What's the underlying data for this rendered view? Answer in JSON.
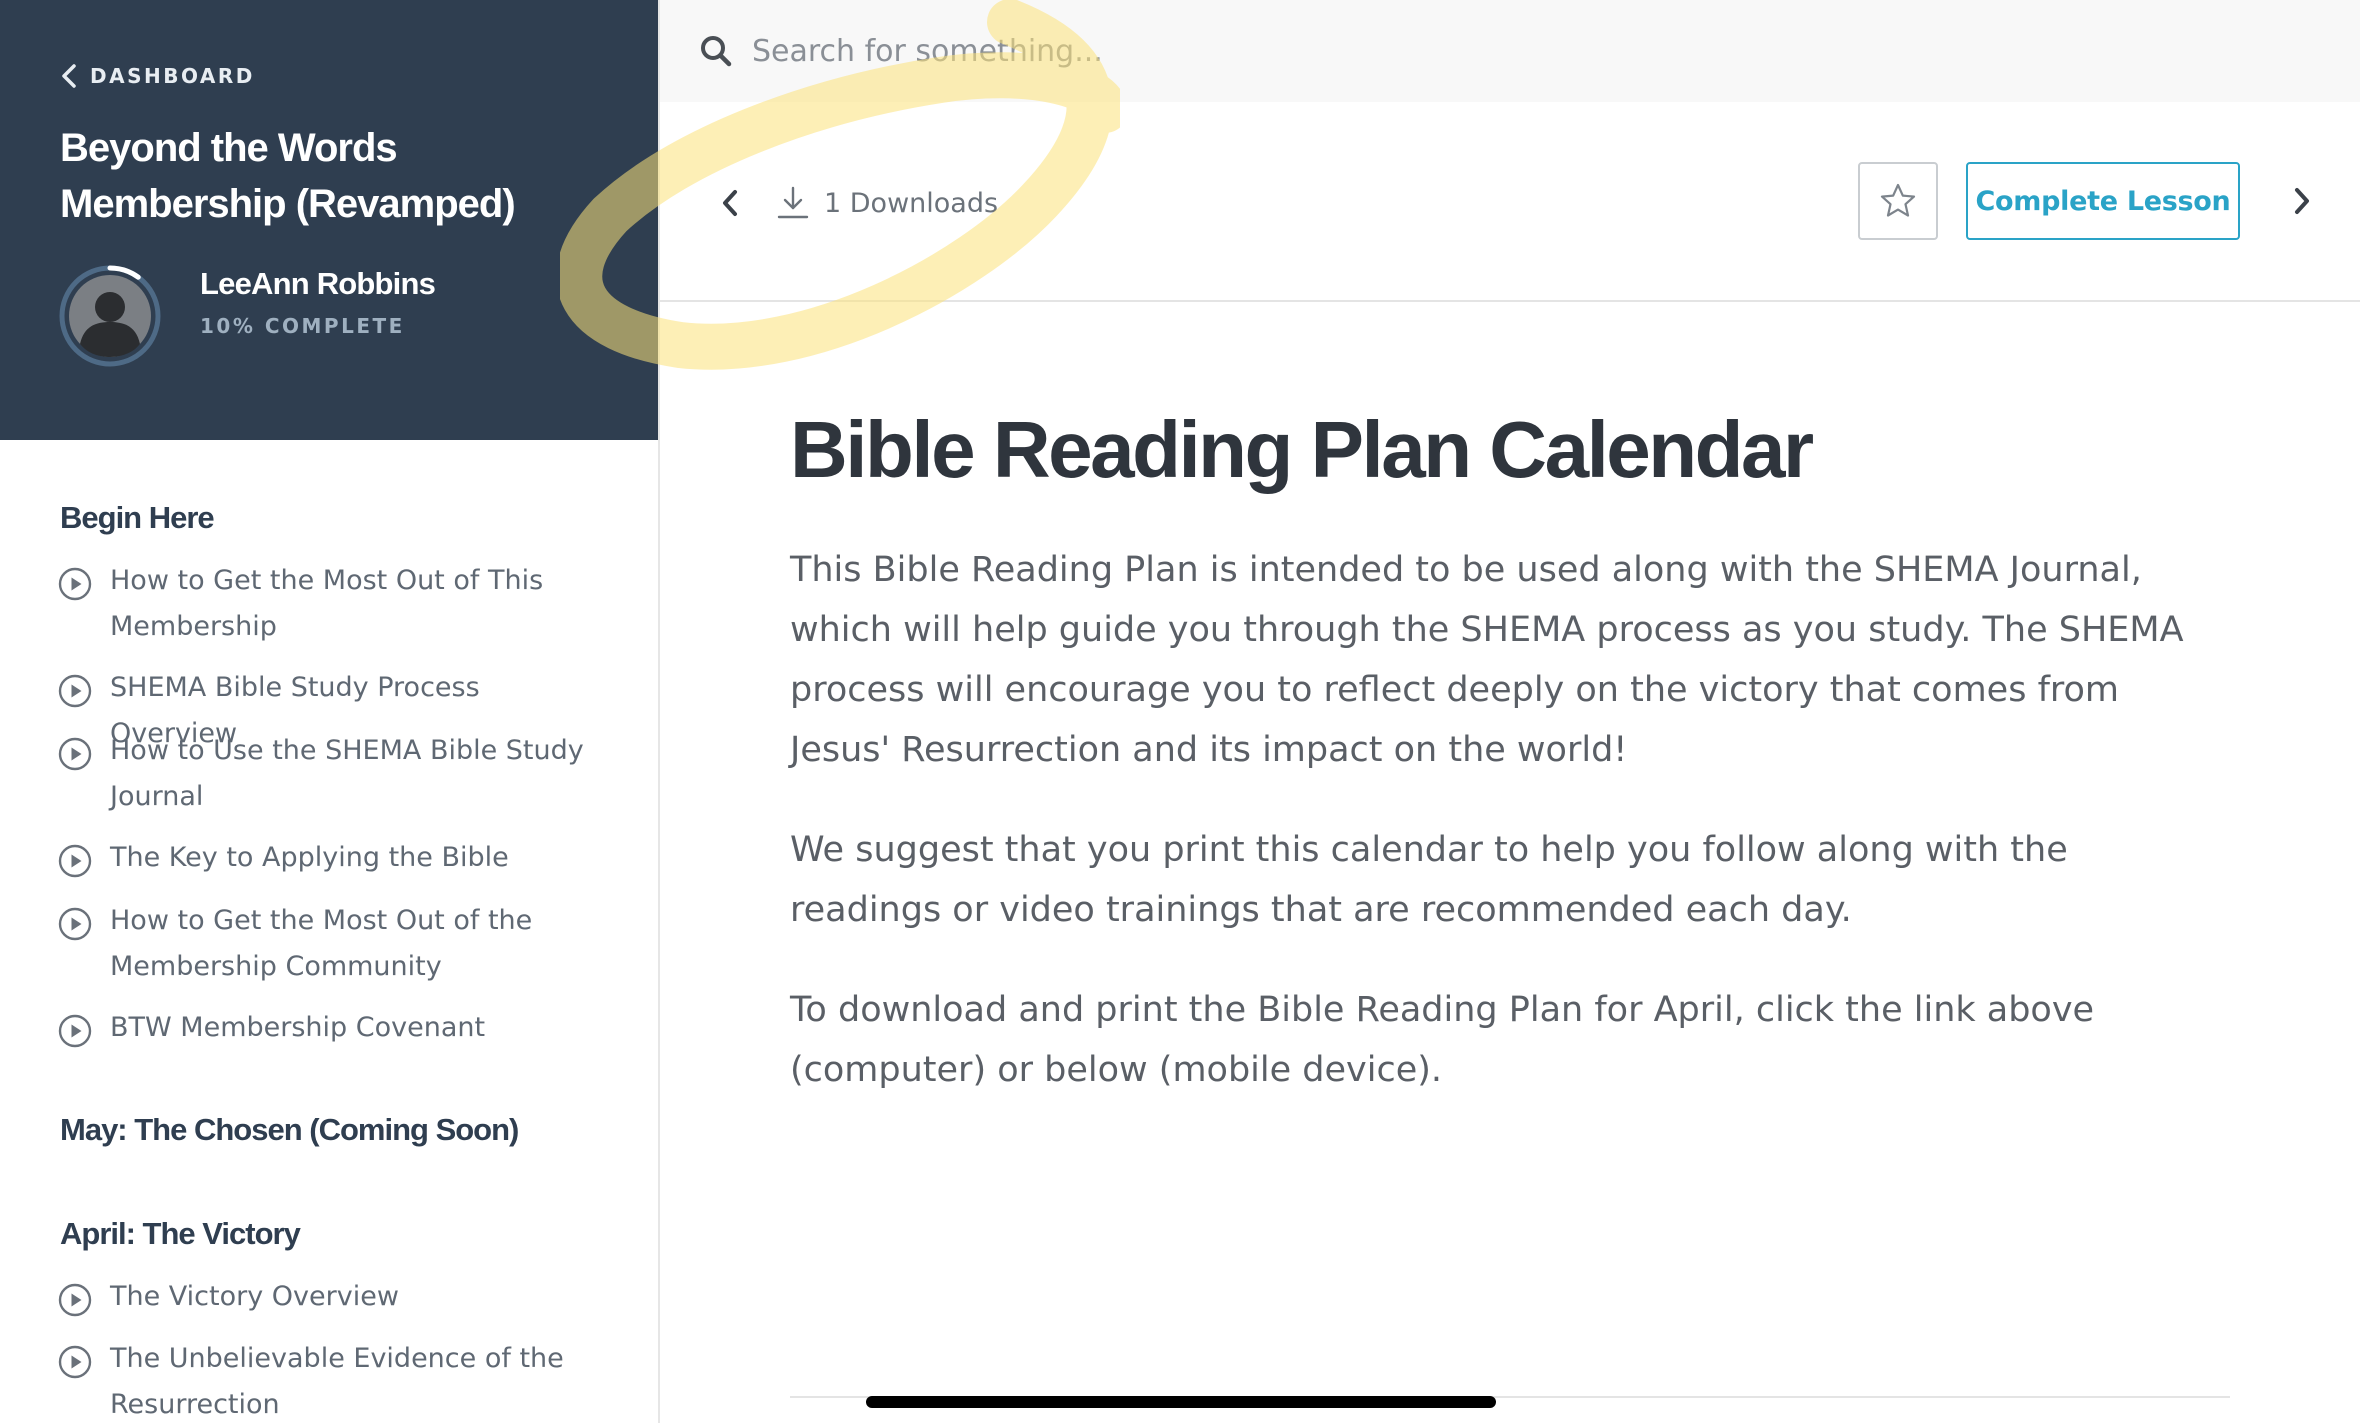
{
  "sidebar": {
    "back_label": "DASHBOARD",
    "course_title": "Beyond the Words Membership (Revamped)",
    "user": {
      "name": "LeeAnn Robbins",
      "progress_text": "10% COMPLETE",
      "progress_fraction": 0.1
    },
    "modules": [
      {
        "title": "Begin Here",
        "lessons": [
          "How to Get the Most Out of This Membership",
          "SHEMA Bible Study Process Overview",
          "How to Use the SHEMA Bible Study Journal",
          "The Key to Applying the Bible",
          "How to Get the Most Out of the Membership Community",
          "BTW Membership Covenant"
        ]
      },
      {
        "title": "May: The Chosen (Coming Soon)",
        "lessons": []
      },
      {
        "title": "April: The Victory",
        "lessons": [
          "The Victory Overview",
          "The Unbelievable Evidence of the Resurrection"
        ]
      }
    ]
  },
  "search": {
    "placeholder": "Search for something..."
  },
  "toolbar": {
    "downloads_label": "1 Downloads",
    "complete_label": "Complete Lesson"
  },
  "lesson": {
    "title": "Bible Reading Plan Calendar",
    "paragraphs": [
      "This Bible Reading Plan is intended to be used along with the SHEMA Journal, which will help guide you through the SHEMA process as you study. The SHEMA process will encourage you to reflect deeply on the victory that comes from Jesus' Resurrection and its impact on the world!",
      "We suggest that you print this calendar to help you follow along with the readings or video trainings that are recommended each day.",
      "To download and print the Bible Reading Plan for April, click the link above (computer) or below (mobile device)."
    ]
  },
  "colors": {
    "sidebar_header_bg": "#2f3e50",
    "accent": "#2aa3c7",
    "highlight": "#fbe27a"
  }
}
